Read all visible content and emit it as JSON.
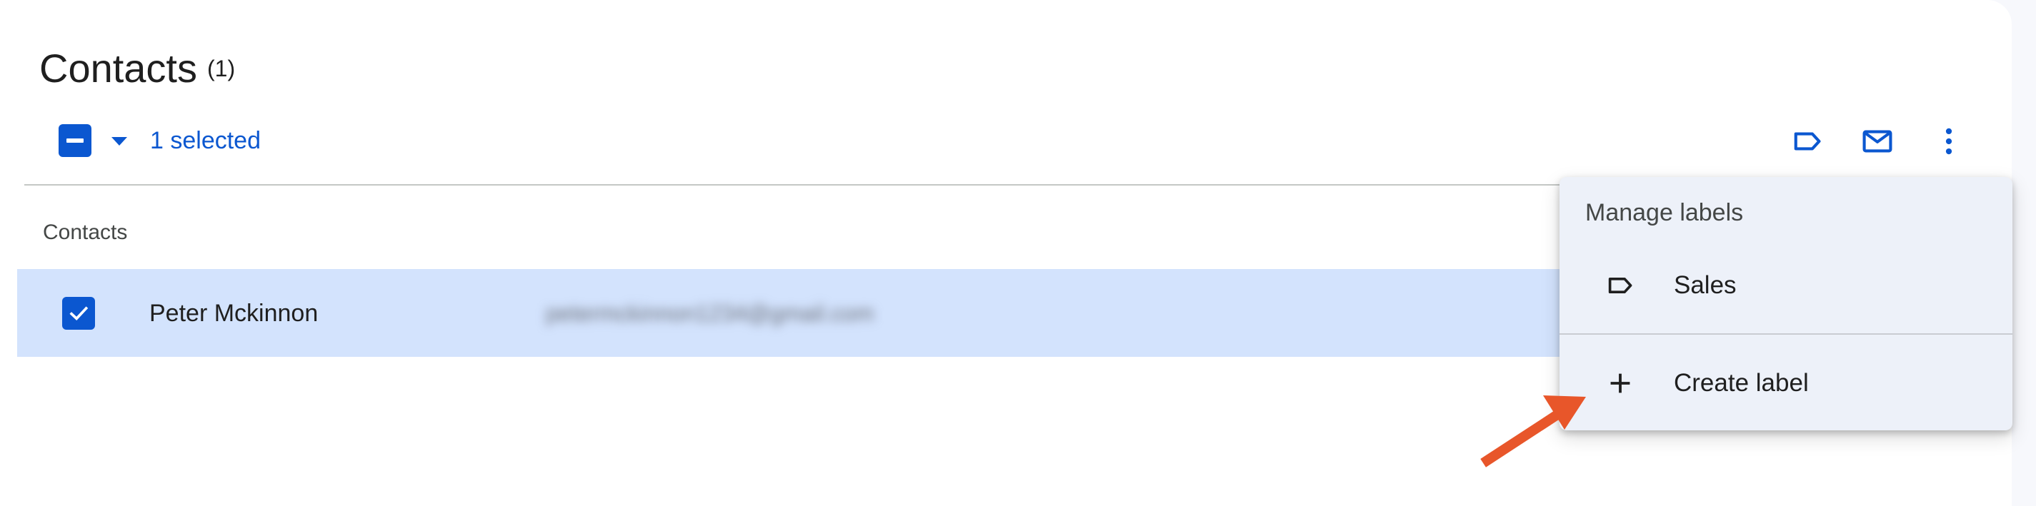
{
  "header": {
    "title": "Contacts",
    "count": "(1)"
  },
  "selection_bar": {
    "selected_label": "1 selected",
    "select_all_icon": "checkbox-indeterminate-icon",
    "dropdown_icon": "caret-down-icon",
    "actions": [
      {
        "name": "manage-labels-button",
        "icon": "label-icon"
      },
      {
        "name": "send-email-button",
        "icon": "mail-icon"
      },
      {
        "name": "more-actions-button",
        "icon": "more-vert-icon"
      }
    ]
  },
  "list": {
    "section_label": "Contacts",
    "rows": [
      {
        "name": "Peter Mckinnon",
        "email": "petermckinnon1234@gmail.com",
        "checked": true
      }
    ]
  },
  "label_menu": {
    "header": "Manage labels",
    "items": [
      {
        "label": "Sales",
        "icon": "label-icon"
      },
      {
        "label": "Create label",
        "icon": "plus-icon"
      }
    ]
  },
  "colors": {
    "accent": "#0b57d0",
    "selected_row": "#d3e3fd",
    "menu_bg": "#edf1f9",
    "annotation_arrow": "#e8562a"
  }
}
